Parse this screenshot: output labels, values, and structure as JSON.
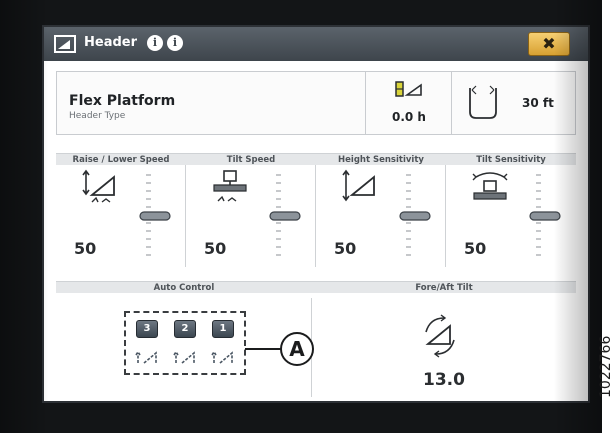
{
  "window": {
    "title": "Header",
    "info_icon": "i",
    "close_label": "✖"
  },
  "header_info": {
    "platform_name": "Flex Platform",
    "platform_subtitle": "Header Type",
    "engine_hours": "0.0 h",
    "header_width": "30 ft"
  },
  "controls": [
    {
      "label": "Raise / Lower Speed",
      "value": "50",
      "icon": "raise-lower-speed-icon",
      "level": 0.5
    },
    {
      "label": "Tilt Speed",
      "value": "50",
      "icon": "tilt-speed-icon",
      "level": 0.5
    },
    {
      "label": "Height Sensitivity",
      "value": "50",
      "icon": "height-sensitivity-icon",
      "level": 0.5
    },
    {
      "label": "Tilt Sensitivity",
      "value": "50",
      "icon": "tilt-sensitivity-icon",
      "level": 0.5
    }
  ],
  "auto_control": {
    "label": "Auto Control",
    "buttons": [
      "3",
      "2",
      "1"
    ]
  },
  "fore_aft_tilt": {
    "label": "Fore/Aft Tilt",
    "value": "13.0"
  },
  "annotation": {
    "callout": "A",
    "figure_number": "1022766"
  },
  "colors": {
    "titlebar": "#4a5158",
    "close_button": "#e8b84e",
    "section_bar": "#e5e7e9",
    "bezel": "#131517"
  }
}
